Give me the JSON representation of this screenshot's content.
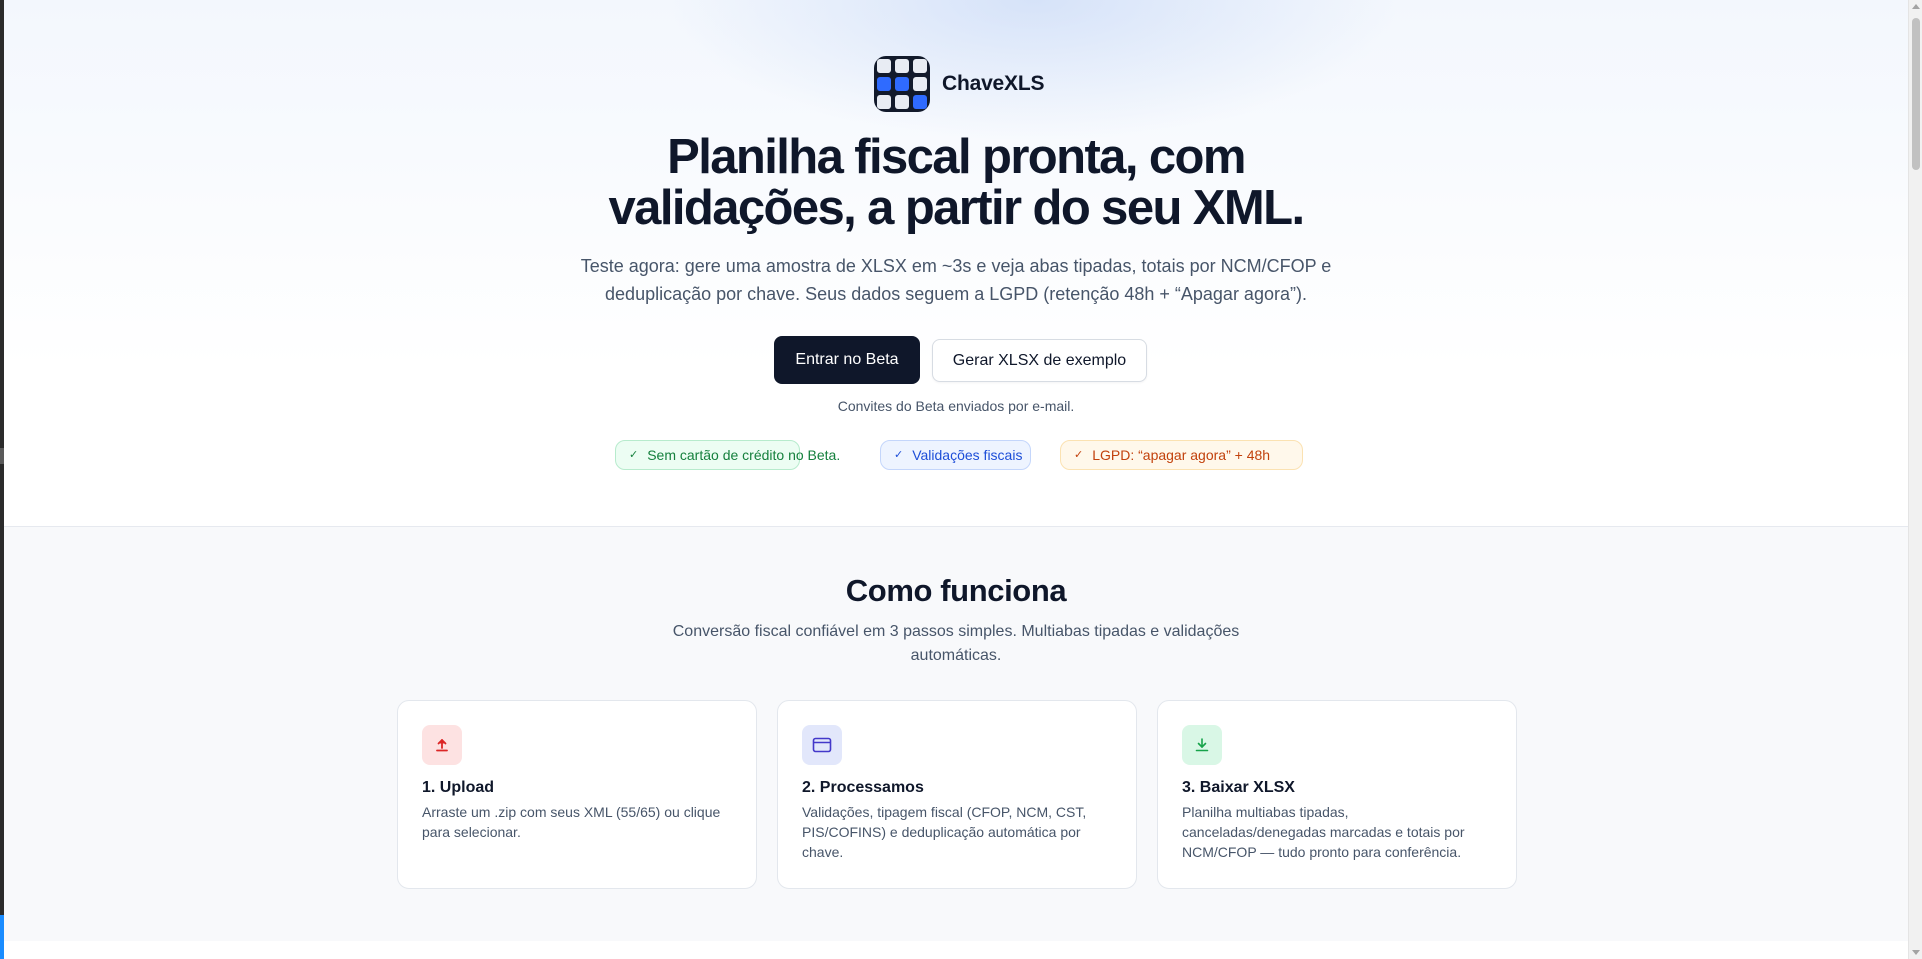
{
  "brand": {
    "name": "ChaveXLS",
    "logo_icon": "grid-logo-icon"
  },
  "hero": {
    "headline": [
      "Planilha fiscal pronta, com",
      "validações, a partir do seu XML."
    ],
    "subtitle": [
      "Teste agora: gere uma amostra de XLSX em ~3s e veja abas tipadas, totais por NCM/CFOP e",
      "deduplicação por chave. Seus dados seguem a LGPD (retenção 48h + “Apagar agora”)."
    ],
    "primary_cta": "Entrar no Beta",
    "secondary_cta": "Gerar XLSX de exemplo",
    "invite_note": "Convites do Beta enviados por e-mail.",
    "badges": [
      {
        "label": "Sem cartão de crédito no Beta.",
        "icon": "check-icon",
        "color": "#15803d"
      },
      {
        "label": "Validações fiscais",
        "icon": "check-icon",
        "color": "#1d4ed8"
      },
      {
        "label": "LGPD: “apagar agora” + 48h",
        "icon": "check-icon",
        "color": "#c2410c"
      }
    ]
  },
  "how_it_works": {
    "title": "Como funciona",
    "subtitle": [
      "Conversão fiscal confiável em 3 passos simples. Multiabas tipadas e validações",
      "automáticas."
    ],
    "steps": [
      {
        "title": "1. Upload",
        "text": "Arraste um .zip com seus XML (55/65) ou clique para selecionar.",
        "icon": "upload-icon",
        "color": "#dc2626"
      },
      {
        "title": "2. Processamos",
        "text": "Validações, tipagem fiscal (CFOP, NCM, CST, PIS/COFINS) e deduplicação automática por chave.",
        "icon": "card-icon",
        "color": "#4338ca"
      },
      {
        "title": "3. Baixar XLSX",
        "text": "Planilha multiabas tipadas, canceladas/denegadas marcadas e totais por NCM/CFOP — tudo pronto para conferência.",
        "icon": "download-icon",
        "color": "#16a34a"
      }
    ]
  },
  "colors": {
    "text": "#0f172a",
    "muted": "#475569",
    "primary_button": "#0f172a",
    "section_bg": "#f8f9fb"
  }
}
